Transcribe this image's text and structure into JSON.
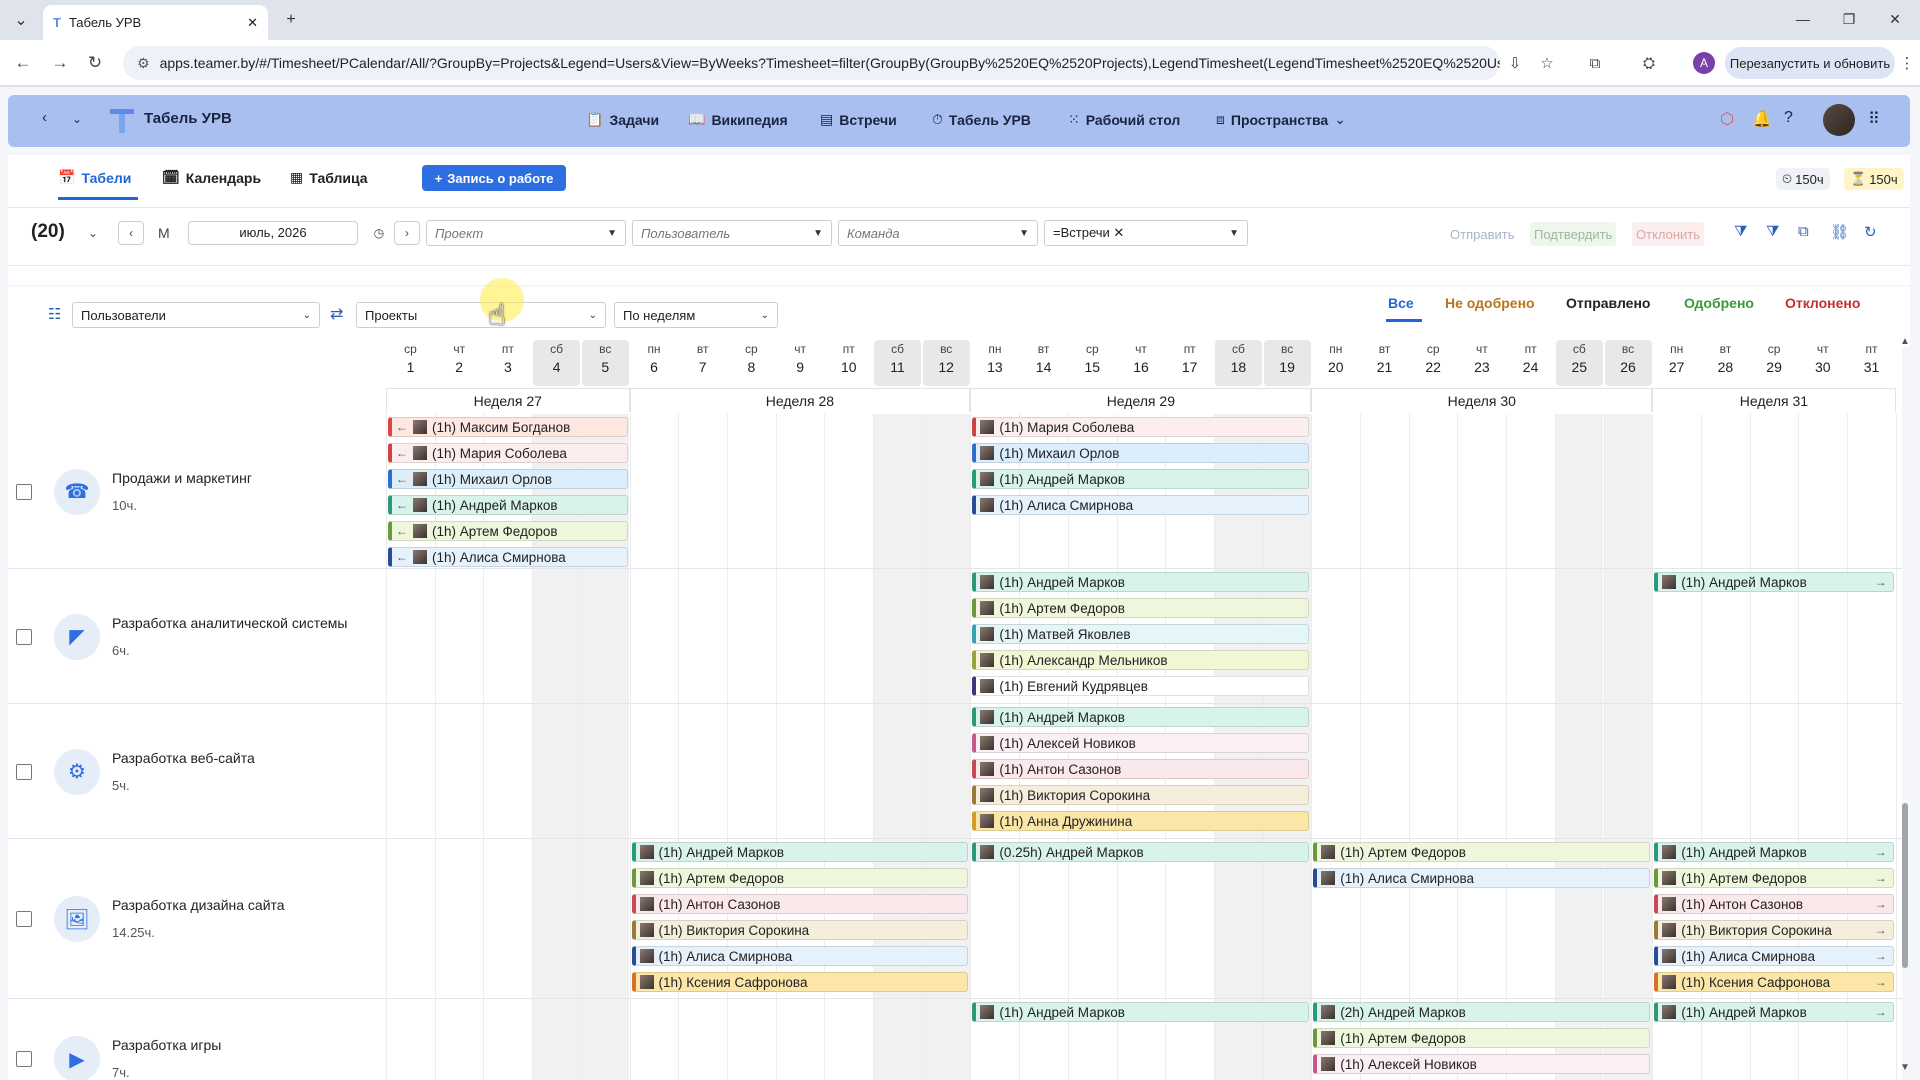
{
  "browser": {
    "tab_title": "Табель УРВ",
    "url": "apps.teamer.by/#/Timesheet/PCalendar/All/?GroupBy=Projects&Legend=Users&View=ByWeeks?Timesheet=filter(GroupBy(GroupBy%2520EQ%2520Projects),LegendTimesheet(LegendTimesheet%2520EQ%2520Use...",
    "profile_letter": "A",
    "relaunch_label": "Перезапустить и обновить"
  },
  "app": {
    "title": "Табель УРВ",
    "nav": [
      "Задачи",
      "Википедия",
      "Встречи",
      "Табель УРВ",
      "Рабочий стол",
      "Пространства"
    ]
  },
  "views": {
    "tabs": [
      "Табели",
      "Календарь",
      "Таблица"
    ],
    "active": "Табели",
    "record_button": "Запись о работе",
    "hours_plan": "150ч",
    "hours_fact": "150ч"
  },
  "filters": {
    "count": "(20)",
    "mode": "М",
    "date": "июль, 2026",
    "project_placeholder": "Проект",
    "user_placeholder": "Пользователь",
    "team_placeholder": "Команда",
    "meeting_tag": "=Встречи",
    "send": "Отправить",
    "confirm": "Подтвердить",
    "reject": "Отклонить"
  },
  "grouping": {
    "legend": "Пользователи",
    "group": "Проекты",
    "period": "По неделям"
  },
  "status_tabs": [
    "Все",
    "Не одобрено",
    "Отправлено",
    "Одобрено",
    "Отклонено"
  ],
  "colors": {
    "accent": "#2166d9",
    "header": "#a8bff0"
  },
  "days": [
    {
      "d": "ср",
      "n": "1"
    },
    {
      "d": "чт",
      "n": "2"
    },
    {
      "d": "пт",
      "n": "3"
    },
    {
      "d": "сб",
      "n": "4"
    },
    {
      "d": "вс",
      "n": "5"
    },
    {
      "d": "пн",
      "n": "6"
    },
    {
      "d": "вт",
      "n": "7"
    },
    {
      "d": "ср",
      "n": "8"
    },
    {
      "d": "чт",
      "n": "9"
    },
    {
      "d": "пт",
      "n": "10"
    },
    {
      "d": "сб",
      "n": "11"
    },
    {
      "d": "вс",
      "n": "12"
    },
    {
      "d": "пн",
      "n": "13"
    },
    {
      "d": "вт",
      "n": "14"
    },
    {
      "d": "ср",
      "n": "15"
    },
    {
      "d": "чт",
      "n": "16"
    },
    {
      "d": "пт",
      "n": "17"
    },
    {
      "d": "сб",
      "n": "18"
    },
    {
      "d": "вс",
      "n": "19"
    },
    {
      "d": "пн",
      "n": "20"
    },
    {
      "d": "вт",
      "n": "21"
    },
    {
      "d": "ср",
      "n": "22"
    },
    {
      "d": "чт",
      "n": "23"
    },
    {
      "d": "пт",
      "n": "24"
    },
    {
      "d": "сб",
      "n": "25"
    },
    {
      "d": "вс",
      "n": "26"
    },
    {
      "d": "пн",
      "n": "27"
    },
    {
      "d": "вт",
      "n": "28"
    },
    {
      "d": "ср",
      "n": "29"
    },
    {
      "d": "чт",
      "n": "30"
    },
    {
      "d": "пт",
      "n": "31"
    }
  ],
  "weeks": [
    "Неделя 27",
    "Неделя 28",
    "Неделя 29",
    "Неделя 30",
    "Неделя 31"
  ],
  "projects": [
    {
      "name": "Продажи и маркетинг",
      "hours": "10ч."
    },
    {
      "name": "Разработка аналитической системы",
      "hours": "6ч."
    },
    {
      "name": "Разработка веб-сайта",
      "hours": "5ч."
    },
    {
      "name": "Разработка дизайна сайта",
      "hours": "14.25ч."
    },
    {
      "name": "Разработка игры",
      "hours": "7ч."
    }
  ],
  "entries": [
    [
      "(1h) Максим Богданов",
      "(1h) Мария Соболева",
      "(1h) Михаил Орлов",
      "(1h) Андрей Марков",
      "(1h) Артем Федоров",
      "(1h) Алиса Смирнова"
    ],
    [
      "(1h) Мария Соболева",
      "(1h) Михаил Орлов",
      "(1h) Андрей Марков",
      "(1h) Алиса Смирнова"
    ],
    [
      "(1h) Андрей Марков",
      "(1h) Артем Федоров",
      "(1h) Матвей Яковлев",
      "(1h) Александр Мельников",
      "(1h) Евгений Кудрявцев"
    ],
    [
      "(1h) Андрей Марков"
    ],
    [
      "(1h) Андрей Марков",
      "(1h) Алексей Новиков",
      "(1h) Антон Сазонов",
      "(1h) Виктория Сорокина",
      "(1h) Анна Дружинина"
    ],
    [
      "(1h) Андрей Марков",
      "(1h) Артем Федоров",
      "(1h) Антон Сазонов",
      "(1h) Виктория Сорокина",
      "(1h) Алиса Смирнова",
      "(1h) Ксения Сафронова"
    ],
    [
      "(0.25h) Андрей Марков"
    ],
    [
      "(1h) Артем Федоров",
      "(1h) Алиса Смирнова"
    ],
    [
      "(1h) Андрей Марков",
      "(1h) Артем Федоров",
      "(1h) Антон Сазонов",
      "(1h) Виктория Сорокина",
      "(1h) Алиса Смирнова",
      "(1h) Ксения Сафронова"
    ],
    [
      "(1h) Андрей Марков"
    ],
    [
      "(2h) Андрей Марков",
      "(1h) Артем Федоров",
      "(1h) Алексей Новиков"
    ],
    [
      "(1h) Андрей Марков"
    ]
  ]
}
